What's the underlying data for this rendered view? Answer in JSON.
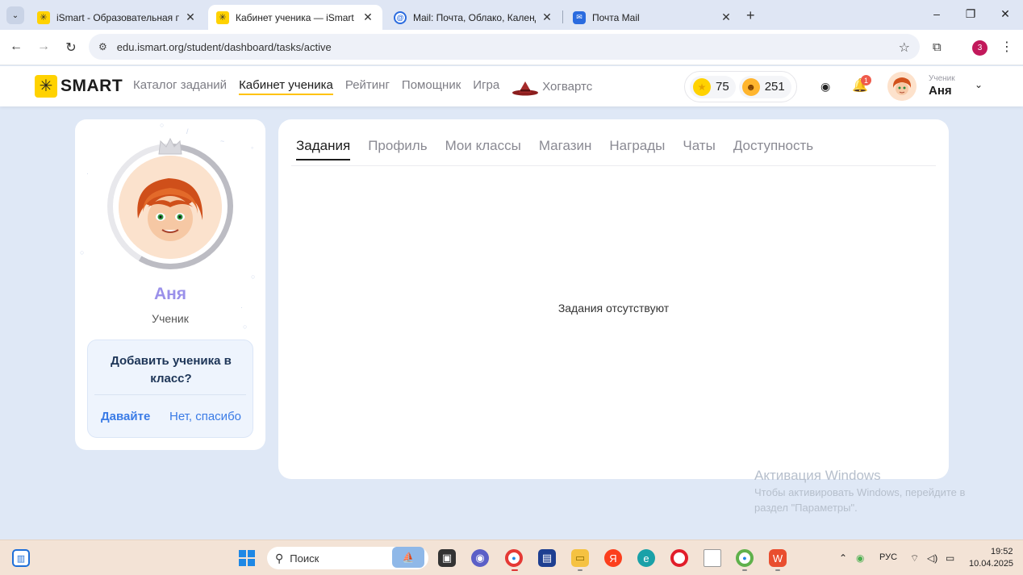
{
  "browser": {
    "tabs": [
      {
        "title": "iSmart - Образовательная пла",
        "favicon": "ismart-icon",
        "active": false
      },
      {
        "title": "Кабинет ученика — iSmart",
        "favicon": "ismart-icon",
        "active": true
      },
      {
        "title": "Mail: Почта, Облако, Календар",
        "favicon": "mail-at-icon",
        "active": false
      },
      {
        "title": "Почта Mail",
        "favicon": "mail-envelope-icon",
        "active": false
      }
    ],
    "url": "edu.ismart.org/student/dashboard/tasks/active",
    "profile_initial": "3",
    "window_controls": {
      "minimize": "–",
      "restore": "❐",
      "close": "✕"
    }
  },
  "header": {
    "logo_text": "SMART",
    "nav": [
      {
        "label": "Каталог заданий",
        "active": false
      },
      {
        "label": "Кабинет ученика",
        "active": true
      },
      {
        "label": "Рейтинг",
        "active": false
      },
      {
        "label": "Помощник",
        "active": false
      },
      {
        "label": "Игра",
        "active": false
      },
      {
        "label": "Хогвартс",
        "active": false
      }
    ],
    "coins": "75",
    "energy": "251",
    "notifications": "1",
    "user_role": "Ученик",
    "user_name": "Аня"
  },
  "profile": {
    "name": "Аня",
    "role": "Ученик",
    "invite_question": "Добавить ученика в класс?",
    "invite_yes": "Давайте",
    "invite_no": "Нет, спасибо"
  },
  "main": {
    "tabs": [
      {
        "label": "Задания",
        "active": true
      },
      {
        "label": "Профиль",
        "active": false
      },
      {
        "label": "Мои классы",
        "active": false
      },
      {
        "label": "Магазин",
        "active": false
      },
      {
        "label": "Награды",
        "active": false
      },
      {
        "label": "Чаты",
        "active": false
      },
      {
        "label": "Доступность",
        "active": false
      }
    ],
    "empty_message": "Задания отсутствуют"
  },
  "watermark": {
    "title": "Активация Windows",
    "line1": "Чтобы активировать Windows, перейдите в",
    "line2": "раздел \"Параметры\"."
  },
  "taskbar": {
    "search_label": "Поиск",
    "language": "РУС",
    "time": "19:52",
    "date": "10.04.2025"
  },
  "colors": {
    "brand_yellow": "#ffd200",
    "accent_purple": "#9a90ea",
    "link_blue": "#3a7be6",
    "page_bg": "#dfe8f6"
  }
}
